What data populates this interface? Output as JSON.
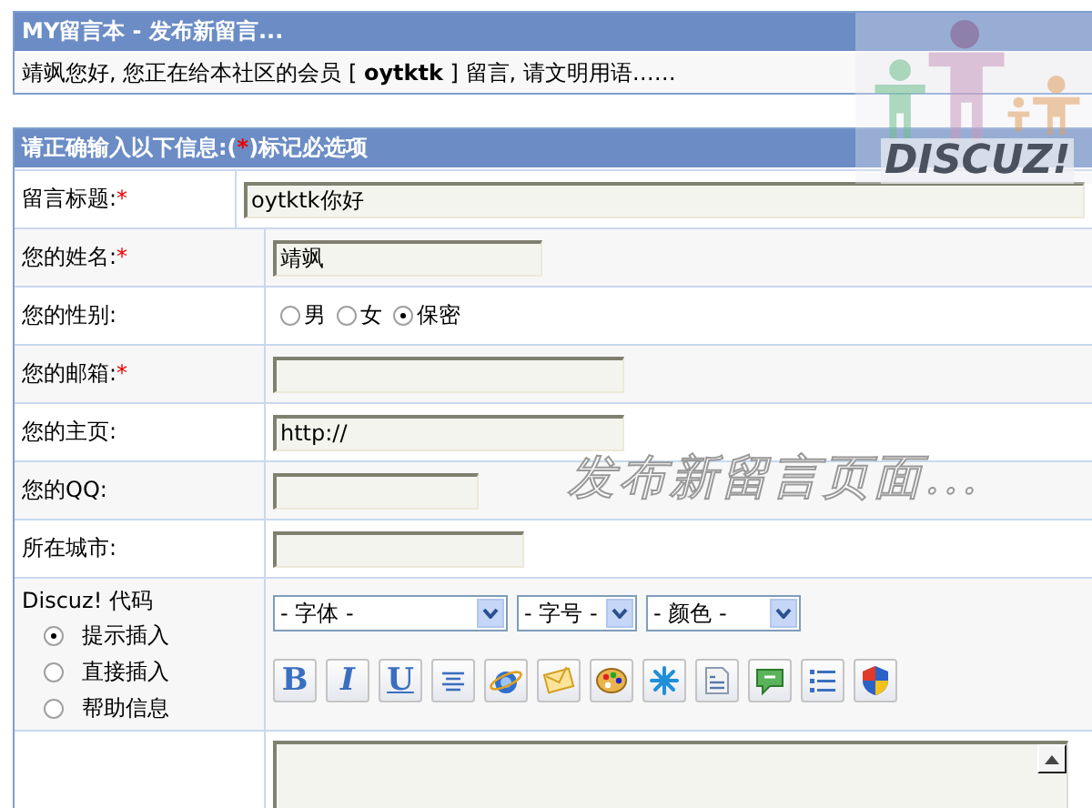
{
  "header": {
    "title": "MY留言本 - 发布新留言...",
    "notice": "靖飒您好, 您正在给本社区的会员 [ **oytktk** ] 留言, 请文明用语……"
  },
  "logo": {
    "text": "DISCUZ!"
  },
  "form": {
    "title_before": "请正确输入以下信息:(",
    "required_mark": "*",
    "title_after": ")标记必选项",
    "fields": [
      {
        "kind": "text",
        "label": "留言标题:",
        "required": true,
        "value": "oytktk你好"
      },
      {
        "kind": "text",
        "label": "您的姓名:",
        "required": true,
        "value": "靖飒"
      },
      {
        "kind": "radio",
        "label": "您的性别:",
        "required": false,
        "options": [
          {
            "label": "男",
            "selected": false
          },
          {
            "label": "女",
            "selected": false
          },
          {
            "label": "保密",
            "selected": true
          }
        ]
      },
      {
        "kind": "text",
        "label": "您的邮箱:",
        "required": true
      },
      {
        "kind": "text",
        "label": "您的主页:",
        "required": false,
        "value": "http://"
      },
      {
        "kind": "text",
        "label": "您的QQ:",
        "required": false
      },
      {
        "kind": "text",
        "label": "所在城市:",
        "required": false
      },
      {
        "kind": "editor",
        "label": "Discuz! 代码",
        "required": false,
        "modes": [
          {
            "label": "提示插入",
            "selected": true
          },
          {
            "label": "直接插入",
            "selected": false
          },
          {
            "label": "帮助信息",
            "selected": false
          }
        ],
        "selects": [
          {
            "value": "- 字体 -"
          },
          {
            "value": "- 字号 -"
          },
          {
            "value": "- 颜色 -"
          }
        ],
        "tools": [
          {
            "kind": "bold",
            "label": "B"
          },
          {
            "kind": "italic",
            "label": "I"
          },
          {
            "kind": "underline",
            "label": "U"
          },
          {
            "kind": "center"
          },
          {
            "kind": "globe"
          },
          {
            "kind": "mail"
          },
          {
            "kind": "palette"
          },
          {
            "kind": "splash"
          },
          {
            "kind": "binary"
          },
          {
            "kind": "speech"
          },
          {
            "kind": "list"
          },
          {
            "kind": "shield"
          }
        ]
      },
      {
        "kind": "textarea"
      }
    ]
  },
  "caption": "发布新留言页面..."
}
